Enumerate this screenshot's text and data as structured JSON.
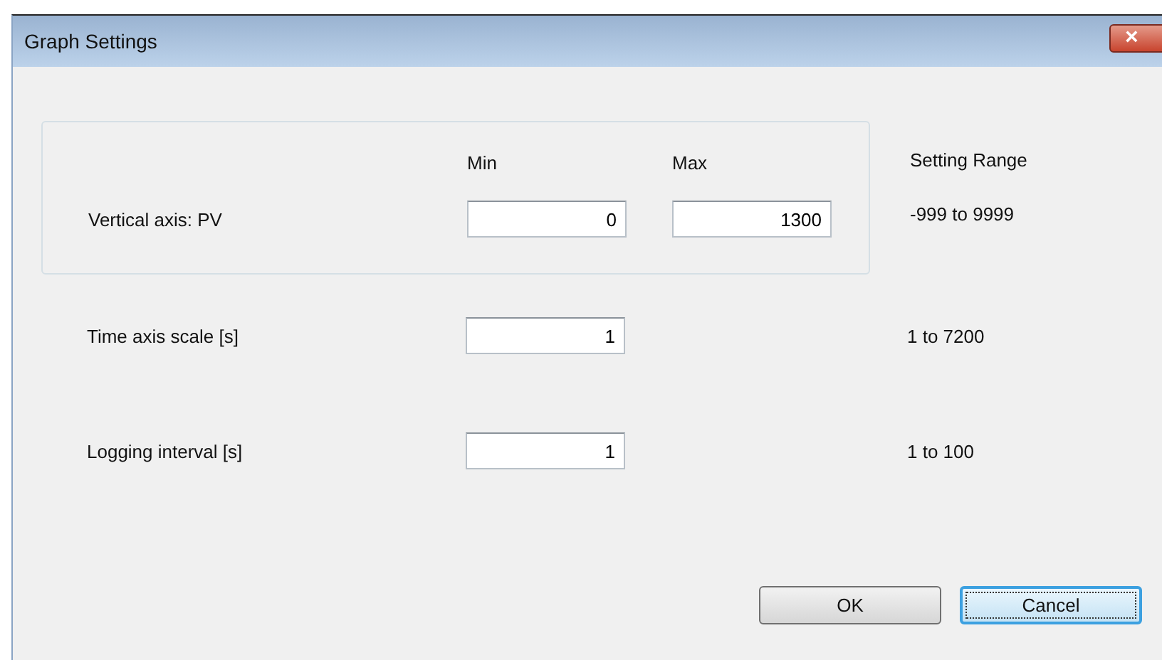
{
  "window": {
    "title": "Graph Settings",
    "close": "×"
  },
  "group": {
    "columns": [
      "Min",
      "Max"
    ],
    "range_heading": "Setting Range",
    "label": "Vertical axis: PV",
    "values": [
      "0",
      "1300"
    ],
    "range": "-999 to 9999"
  },
  "rows": [
    {
      "label": "Time axis scale [s]",
      "value": "1",
      "range": "1 to 7200"
    },
    {
      "label": "Logging interval [s]",
      "value": "1",
      "range": "1 to 100"
    }
  ],
  "buttons": [
    {
      "label": "OK",
      "focused": false
    },
    {
      "label": "Cancel",
      "focused": true
    }
  ]
}
